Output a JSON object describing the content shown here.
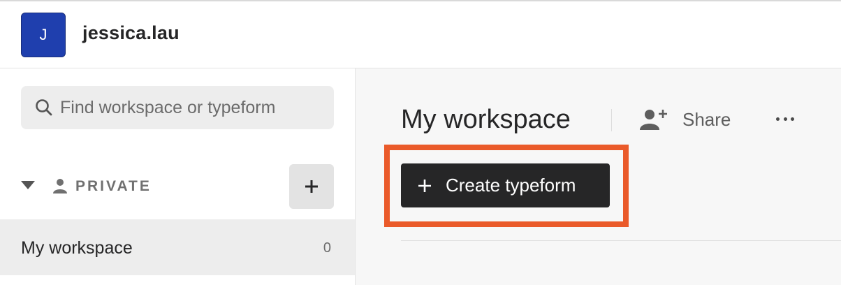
{
  "header": {
    "avatar_initial": "J",
    "avatar_color": "#1f3fae",
    "username": "jessica.lau"
  },
  "sidebar": {
    "search": {
      "icon": "search-icon",
      "placeholder": "Find workspace or typeform",
      "value": ""
    },
    "private_section": {
      "toggle_icon": "caret-down-icon",
      "icon": "person-icon",
      "label": "PRIVATE",
      "add_icon": "plus-icon"
    },
    "workspaces": [
      {
        "name": "My workspace",
        "count": "0",
        "selected": true
      }
    ]
  },
  "main": {
    "title": "My workspace",
    "share": {
      "icon": "add-person-icon",
      "label": "Share"
    },
    "more_icon": "more-horizontal-icon",
    "create_button": {
      "icon": "plus-icon",
      "label": "Create typeform"
    },
    "highlight_color": "#ea5a2a"
  }
}
